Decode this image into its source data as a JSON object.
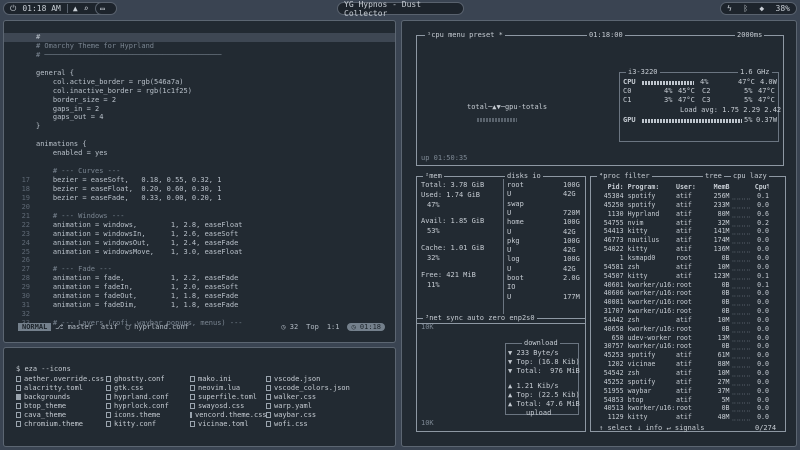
{
  "topbar": {
    "time": "01:18 AM",
    "center": "YG Hypnos - Dust Collector",
    "battery": "38%"
  },
  "editor": {
    "lines": [
      {
        "n": "",
        "t": "#",
        "cls": "cur"
      },
      {
        "n": "",
        "t": "# Omarchy Theme for Hyprland",
        "cls": "sep"
      },
      {
        "n": "",
        "t": "# ──────────────────────────────────────────",
        "cls": "sep"
      },
      {
        "n": "",
        "t": "",
        "cls": ""
      },
      {
        "n": "",
        "t": "general {",
        "cls": ""
      },
      {
        "n": "",
        "t": "    col.active_border = rgb(546a7a)",
        "cls": ""
      },
      {
        "n": "",
        "t": "    col.inactive_border = rgb(1c1f25)",
        "cls": ""
      },
      {
        "n": "",
        "t": "    border_size = 2",
        "cls": ""
      },
      {
        "n": "",
        "t": "    gaps_in = 2",
        "cls": ""
      },
      {
        "n": "",
        "t": "    gaps_out = 4",
        "cls": ""
      },
      {
        "n": "",
        "t": "}",
        "cls": ""
      },
      {
        "n": "",
        "t": "",
        "cls": ""
      },
      {
        "n": "",
        "t": "animations {",
        "cls": ""
      },
      {
        "n": "",
        "t": "    enabled = yes",
        "cls": ""
      },
      {
        "n": "",
        "t": "",
        "cls": ""
      },
      {
        "n": "",
        "t": "    # --- Curves ---",
        "cls": "sep"
      },
      {
        "n": "17",
        "t": "    bezier = easeSoft,   0.18, 0.55, 0.32, 1",
        "cls": ""
      },
      {
        "n": "18",
        "t": "    bezier = easeFloat,  0.20, 0.60, 0.30, 1",
        "cls": ""
      },
      {
        "n": "19",
        "t": "    bezier = easeFade,   0.33, 0.00, 0.20, 1",
        "cls": ""
      },
      {
        "n": "20",
        "t": "",
        "cls": ""
      },
      {
        "n": "21",
        "t": "    # --- Windows ---",
        "cls": "sep"
      },
      {
        "n": "22",
        "t": "    animation = windows,        1, 2.8, easeFloat",
        "cls": ""
      },
      {
        "n": "23",
        "t": "    animation = windowsIn,      1, 2.6, easeSoft",
        "cls": ""
      },
      {
        "n": "24",
        "t": "    animation = windowsOut,     1, 2.4, easeFade",
        "cls": ""
      },
      {
        "n": "25",
        "t": "    animation = windowsMove,    1, 3.0, easeFloat",
        "cls": ""
      },
      {
        "n": "26",
        "t": "",
        "cls": ""
      },
      {
        "n": "27",
        "t": "    # --- Fade ---",
        "cls": "sep"
      },
      {
        "n": "28",
        "t": "    animation = fade,           1, 2.2, easeFade",
        "cls": ""
      },
      {
        "n": "29",
        "t": "    animation = fadeIn,         1, 2.0, easeSoft",
        "cls": ""
      },
      {
        "n": "30",
        "t": "    animation = fadeOut,        1, 1.8, easeFade",
        "cls": ""
      },
      {
        "n": "31",
        "t": "    animation = fadeDim,        1, 1.8, easeFade",
        "cls": ""
      },
      {
        "n": "32",
        "t": "",
        "cls": ""
      },
      {
        "n": "33",
        "t": "    # --- Layers (rofi, waybar popups, menus) ---",
        "cls": "sep"
      }
    ],
    "status": {
      "mode": "NORMAL",
      "branch": "master",
      "cwd": "atif",
      "file": "hyprland.conf",
      "lines": "32",
      "scroll": "Top",
      "pos": "1:1",
      "clock": "01:18"
    }
  },
  "terminal": {
    "prompt": "eza --icons",
    "files": [
      {
        "name": "aether.override.css",
        "dir": false
      },
      {
        "name": "alacritty.toml",
        "dir": false
      },
      {
        "name": "backgrounds",
        "dir": true
      },
      {
        "name": "btop_theme",
        "dir": false
      },
      {
        "name": "cava_theme",
        "dir": false
      },
      {
        "name": "chromium.theme",
        "dir": false
      },
      {
        "name": "ghostty.conf",
        "dir": false
      },
      {
        "name": "gtk.css",
        "dir": false
      },
      {
        "name": "hyprland.conf",
        "dir": false
      },
      {
        "name": "hyprlock.conf",
        "dir": false
      },
      {
        "name": "icons.theme",
        "dir": false
      },
      {
        "name": "kitty.conf",
        "dir": false
      },
      {
        "name": "mako.ini",
        "dir": false
      },
      {
        "name": "neovim.lua",
        "dir": false
      },
      {
        "name": "superfile.toml",
        "dir": false
      },
      {
        "name": "swayosd.css",
        "dir": false
      },
      {
        "name": "vencord.theme.css",
        "dir": false
      },
      {
        "name": "vicinae.toml",
        "dir": false
      },
      {
        "name": "vscode.json",
        "dir": false
      },
      {
        "name": "vscode_colors.json",
        "dir": false
      },
      {
        "name": "walker.css",
        "dir": false
      },
      {
        "name": "warp.yaml",
        "dir": false
      },
      {
        "name": "waybar.css",
        "dir": false
      },
      {
        "name": "wofi.css",
        "dir": false
      }
    ]
  },
  "btop": {
    "cpu_box": {
      "title": "¹cpu",
      "menu": "menu",
      "preset": "preset *",
      "clock": "01:18:00",
      "refresh": "2000ms",
      "model": "i3-3220",
      "freq": "1.6 GHz",
      "total_label": "total",
      "gpu_label": "gpu-totals",
      "uptime": "up 01:50:35",
      "rows": [
        {
          "name": "CPU",
          "pct": "4%",
          "temp": "47°C",
          "extra": "4.0W"
        },
        {
          "name": "C0",
          "pct": "4%",
          "temp": "45°C",
          "core2": "C2",
          "pct2": "5%",
          "temp2": "47°C"
        },
        {
          "name": "C1",
          "pct": "3%",
          "temp": "47°C",
          "core2": "C3",
          "pct2": "5%",
          "temp2": "47°C"
        }
      ],
      "load_avg": "Load avg: 1.75 2.29 2.42",
      "gpu": {
        "name": "GPU",
        "pct": "5%",
        "watts": "0.37W"
      }
    },
    "mem": {
      "title": "²mem",
      "total": "Total:",
      "total_v": "3.78 GiB",
      "used": "Used:",
      "used_v": "1.74 GiB",
      "used_p": "47%",
      "avail": "Avail:",
      "avail_v": "1.85 GiB",
      "avail_p": "53%",
      "cache": "Cache:",
      "cache_v": "1.01 GiB",
      "cache_p": "32%",
      "free": "Free:",
      "free_v": "421 MiB",
      "free_p": "11%"
    },
    "disks": {
      "title": "disks",
      "io": "io",
      "rows": [
        {
          "name": "root",
          "v": "100G"
        },
        {
          "name": "U",
          "v": "42G"
        },
        {
          "name": "swap",
          "v": ""
        },
        {
          "name": "U",
          "v": "720M"
        },
        {
          "name": "home",
          "v": "100G"
        },
        {
          "name": "U",
          "v": "42G"
        },
        {
          "name": "pkg",
          "v": "100G"
        },
        {
          "name": "U",
          "v": "42G"
        },
        {
          "name": "log",
          "v": "100G"
        },
        {
          "name": "U",
          "v": "42G"
        },
        {
          "name": "boot",
          "v": "2.0G"
        },
        {
          "name": "IO",
          "v": ""
        },
        {
          "name": "U",
          "v": "177M"
        }
      ]
    },
    "net": {
      "title": "³net",
      "sync": "sync",
      "auto": "auto",
      "zero": "zero",
      "iface": "enp2s0",
      "scale_top": "10K",
      "scale_bottom": "10K",
      "download_label": "download",
      "download_rate": "233 Byte/s",
      "download_top": "Top: (16.8 Kib)",
      "download_total": "Total:  976 MiB",
      "upload_rate": "1.21 Kib/s",
      "upload_top": "Top: (22.5 Kib)",
      "upload_total": "Total: 47.6 MiB",
      "upload_label": "upload"
    },
    "proc": {
      "title": "⁴proc",
      "filter": "filter",
      "tree": "tree",
      "sort": "cpu lazy",
      "headers": {
        "pid": "Pid:",
        "name": "Program:",
        "user": "User:",
        "mem": "MemB",
        "cpu": "Cpu%"
      },
      "footer_select": "select",
      "footer_info": "info",
      "footer_signals": "signals",
      "footer_count": "0/274",
      "rows": [
        {
          "pid": "45384",
          "name": "spotify",
          "user": "atif",
          "mem": "256M",
          "cpu": "0.1"
        },
        {
          "pid": "45250",
          "name": "spotify",
          "user": "atif",
          "mem": "233M",
          "cpu": "0.0"
        },
        {
          "pid": "1130",
          "name": "Hyprland",
          "user": "atif",
          "mem": "80M",
          "cpu": "0.6"
        },
        {
          "pid": "54755",
          "name": "nvim",
          "user": "atif",
          "mem": "32M",
          "cpu": "0.2"
        },
        {
          "pid": "54413",
          "name": "kitty",
          "user": "atif",
          "mem": "141M",
          "cpu": "0.0"
        },
        {
          "pid": "46773",
          "name": "nautilus",
          "user": "atif",
          "mem": "174M",
          "cpu": "0.0"
        },
        {
          "pid": "54022",
          "name": "kitty",
          "user": "atif",
          "mem": "136M",
          "cpu": "0.0"
        },
        {
          "pid": "1",
          "name": "ksmapd0",
          "user": "root",
          "mem": "0B",
          "cpu": "0.0"
        },
        {
          "pid": "54581",
          "name": "zsh",
          "user": "atif",
          "mem": "10M",
          "cpu": "0.0"
        },
        {
          "pid": "54507",
          "name": "kitty",
          "user": "atif",
          "mem": "123M",
          "cpu": "0.1"
        },
        {
          "pid": "40601",
          "name": "kworker/u16:",
          "user": "root",
          "mem": "0B",
          "cpu": "0.1"
        },
        {
          "pid": "40606",
          "name": "kworker/u16:",
          "user": "root",
          "mem": "0B",
          "cpu": "0.0"
        },
        {
          "pid": "40081",
          "name": "kworker/u16:",
          "user": "root",
          "mem": "0B",
          "cpu": "0.0"
        },
        {
          "pid": "31707",
          "name": "kworker/u16:",
          "user": "root",
          "mem": "0B",
          "cpu": "0.0"
        },
        {
          "pid": "54442",
          "name": "zsh",
          "user": "atif",
          "mem": "10M",
          "cpu": "0.0"
        },
        {
          "pid": "40658",
          "name": "kworker/u16:",
          "user": "root",
          "mem": "0B",
          "cpu": "0.0"
        },
        {
          "pid": "650",
          "name": "udev-worker",
          "user": "root",
          "mem": "13M",
          "cpu": "0.0"
        },
        {
          "pid": "30757",
          "name": "kworker/u16:",
          "user": "root",
          "mem": "0B",
          "cpu": "0.0"
        },
        {
          "pid": "45253",
          "name": "spotify",
          "user": "atif",
          "mem": "61M",
          "cpu": "0.0"
        },
        {
          "pid": "1202",
          "name": "vicinae",
          "user": "atif",
          "mem": "88M",
          "cpu": "0.0"
        },
        {
          "pid": "54542",
          "name": "zsh",
          "user": "atif",
          "mem": "10M",
          "cpu": "0.0"
        },
        {
          "pid": "45252",
          "name": "spotify",
          "user": "atif",
          "mem": "27M",
          "cpu": "0.0"
        },
        {
          "pid": "51955",
          "name": "waybar",
          "user": "atif",
          "mem": "37M",
          "cpu": "0.0"
        },
        {
          "pid": "54853",
          "name": "btop",
          "user": "atif",
          "mem": "5M",
          "cpu": "0.0"
        },
        {
          "pid": "40513",
          "name": "kworker/u16:",
          "user": "root",
          "mem": "0B",
          "cpu": "0.0"
        },
        {
          "pid": "1129",
          "name": "kitty",
          "user": "atif",
          "mem": "48M",
          "cpu": "0.0"
        }
      ]
    }
  }
}
